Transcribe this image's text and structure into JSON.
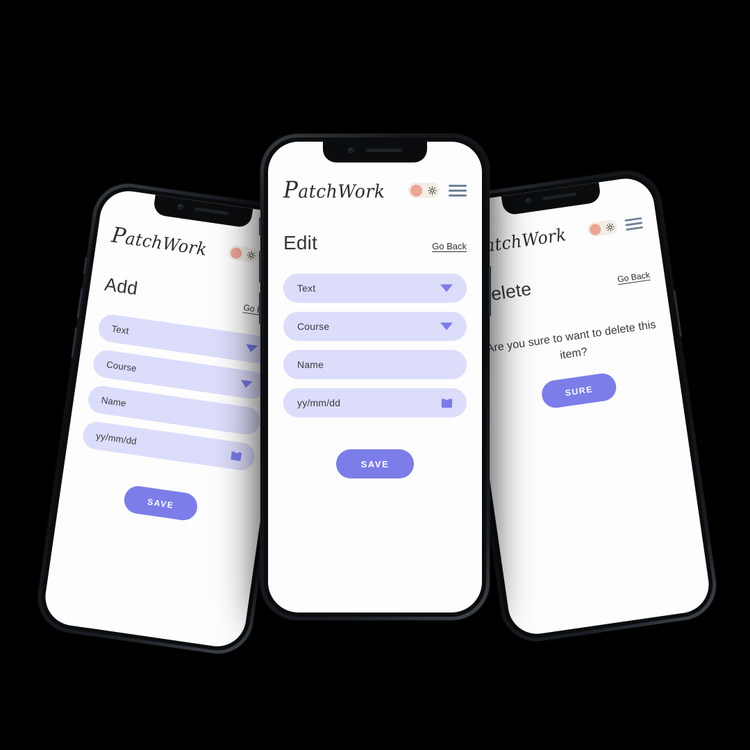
{
  "brand": {
    "logo_text": "PatchWork",
    "logo_initial": "P",
    "logo_rest": "atchWork",
    "accent_color": "#7c7de8",
    "field_color": "#dcdcfb",
    "toggle_track_color": "#f2ece4",
    "toggle_knob_color": "#eba695",
    "hamburger_color": "#6f8299",
    "screen_bg": "#fdfdfd",
    "frame_color": "#0b0d10",
    "page_bg": "#000000"
  },
  "icons": {
    "sun": "sun-icon",
    "menu": "hamburger-menu-icon",
    "caret": "chevron-down-icon",
    "calendar": "calendar-icon",
    "camera": "front-camera-icon",
    "speaker": "earpiece-speaker"
  },
  "common": {
    "go_back_label": "Go Back",
    "save_label": "SAVE"
  },
  "screens": [
    {
      "id": "add",
      "title": "Add",
      "go_back": "Go Back",
      "fields": [
        {
          "label": "Text",
          "trailing": "caret"
        },
        {
          "label": "Course",
          "trailing": "caret"
        },
        {
          "label": "Name",
          "trailing": "none"
        },
        {
          "label": "yy/mm/dd",
          "trailing": "calendar"
        }
      ],
      "primary_button": "SAVE"
    },
    {
      "id": "edit",
      "title": "Edit",
      "go_back": "Go Back",
      "fields": [
        {
          "label": "Text",
          "trailing": "caret"
        },
        {
          "label": "Course",
          "trailing": "caret"
        },
        {
          "label": "Name",
          "trailing": "none"
        },
        {
          "label": "yy/mm/dd",
          "trailing": "calendar"
        }
      ],
      "primary_button": "SAVE"
    },
    {
      "id": "delete",
      "title": "Delete",
      "go_back": "Go Back",
      "message": "Are you sure to want to delete this item?",
      "primary_button": "SURE"
    }
  ]
}
